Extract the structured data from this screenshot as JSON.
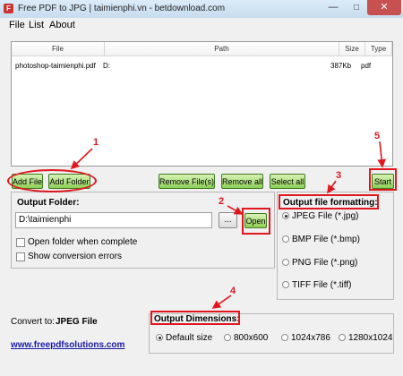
{
  "window": {
    "title": "Free PDF to JPG | taimienphi.vn - betdownload.com",
    "app_icon": "F",
    "min_glyph": "—",
    "max_glyph": "□",
    "close_glyph": "✕"
  },
  "menu": [
    "File",
    "List",
    "About"
  ],
  "file_list": {
    "headers": [
      "File",
      "Path",
      "Size",
      "Type"
    ],
    "rows": [
      {
        "file": "photoshop-taimienphi.pdf",
        "path": "D:",
        "size": "387Kb",
        "type": "pdf"
      }
    ]
  },
  "buttons": {
    "add_file": "Add File",
    "add_folder": "Add Folder",
    "remove_files": "Remove File(s)",
    "remove_all": "Remove all",
    "select_all": "Select all",
    "start": "Start",
    "browse": "...",
    "open": "Open"
  },
  "output_folder": {
    "label": "Output Folder:",
    "value": "D:\\taimienphi",
    "open_when_complete": "Open folder when complete",
    "show_errors": "Show conversion errors"
  },
  "formatting": {
    "title": "Output file formatting:",
    "options": [
      "JPEG File (*.jpg)",
      "BMP File (*.bmp)",
      "PNG File (*.png)",
      "TIFF File (*.tiff)"
    ],
    "selected": "JPEG File (*.jpg)"
  },
  "convert_to": {
    "label": "Convert to:",
    "value": "JPEG File"
  },
  "website": "www.freepdfsolutions.com",
  "dimensions": {
    "title": "Output Dimensions:",
    "options": [
      "Default size",
      "800x600",
      "1024x786",
      "1280x1024"
    ],
    "selected": "Default size"
  },
  "annotations": [
    "1",
    "2",
    "3",
    "4",
    "5"
  ],
  "colors": {
    "annotation": "#e0171f",
    "button_green": "#8fcf58",
    "link": "#1a1aa8"
  }
}
